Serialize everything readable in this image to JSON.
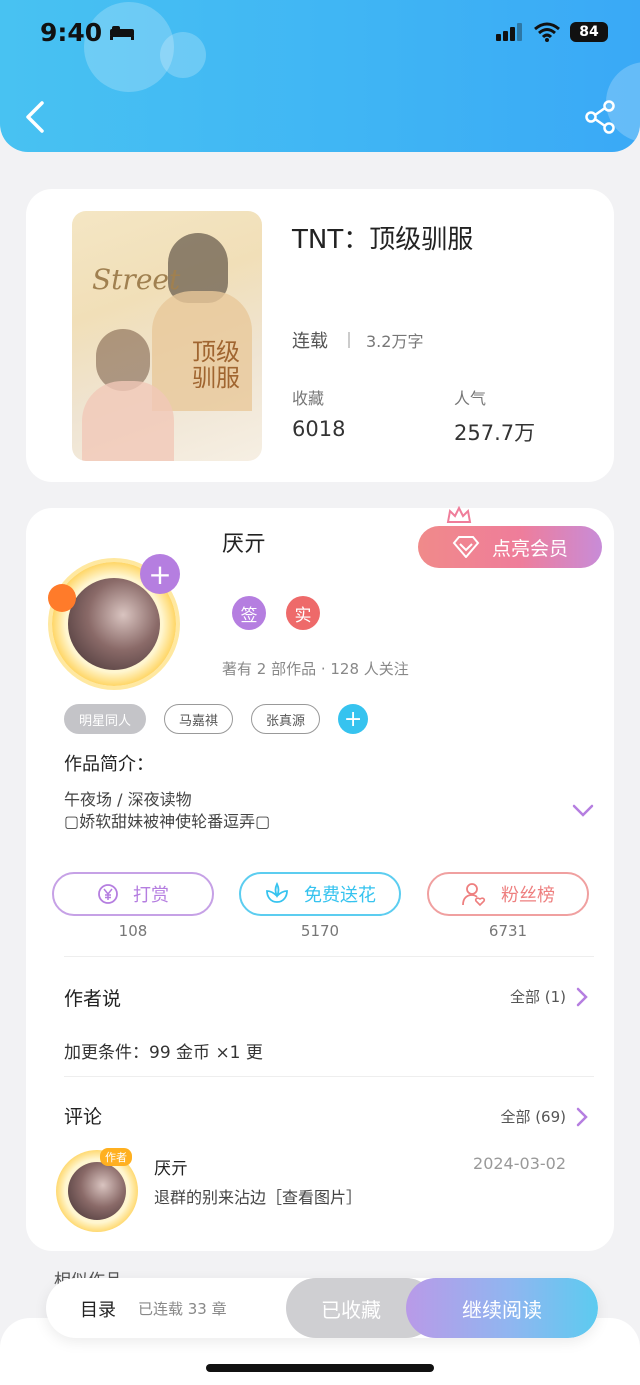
{
  "status_bar": {
    "time": "9:40",
    "battery": "84"
  },
  "header": {
    "back_icon": "chevron-left-icon",
    "share_icon": "share-icon"
  },
  "book": {
    "title": "TNT：顶级驯服",
    "status": "连载",
    "words": "3.2万字",
    "favorites_label": "收藏",
    "favorites_value": "6018",
    "popularity_label": "人气",
    "popularity_value": "257.7万",
    "cover": {
      "script_text": "Street",
      "title_text": "顶级驯服"
    }
  },
  "author": {
    "name": "厌亓",
    "vip_label": "点亮会员",
    "badge_sign": "签",
    "badge_real": "实",
    "meta": "著有 2 部作品 · 128 人关注",
    "tags": [
      "明星同人",
      "马嘉祺",
      "张真源"
    ]
  },
  "intro": {
    "label": "作品简介：",
    "line1": "午夜场 / 深夜读物",
    "line2": "▢娇软甜妹被神使轮番逗弄▢"
  },
  "actions": {
    "reward_label": "打赏",
    "reward_count": "108",
    "flower_label": "免费送花",
    "flower_count": "5170",
    "fans_label": "粉丝榜",
    "fans_count": "6731"
  },
  "author_says": {
    "title": "作者说",
    "more": "全部 (1)",
    "condition": "加更条件：99 金币 ×1 更"
  },
  "comments": {
    "title": "评论",
    "more": "全部 (69)",
    "items": [
      {
        "badge": "作者",
        "name": "厌亓",
        "date": "2024-03-02",
        "text": "退群的别来沾边［查看图片］"
      }
    ]
  },
  "similar_title": "相似作品",
  "bottom_bar": {
    "toc_label": "目录",
    "chapter_count": "已连载 33 章",
    "favorited_label": "已收藏",
    "read_label": "继续阅读"
  },
  "colors": {
    "header": "#3fb4f4",
    "vip": "#ef7d9a",
    "reward": "#b57ee0",
    "flower": "#36c3ef",
    "fans": "#ee7f7f"
  }
}
